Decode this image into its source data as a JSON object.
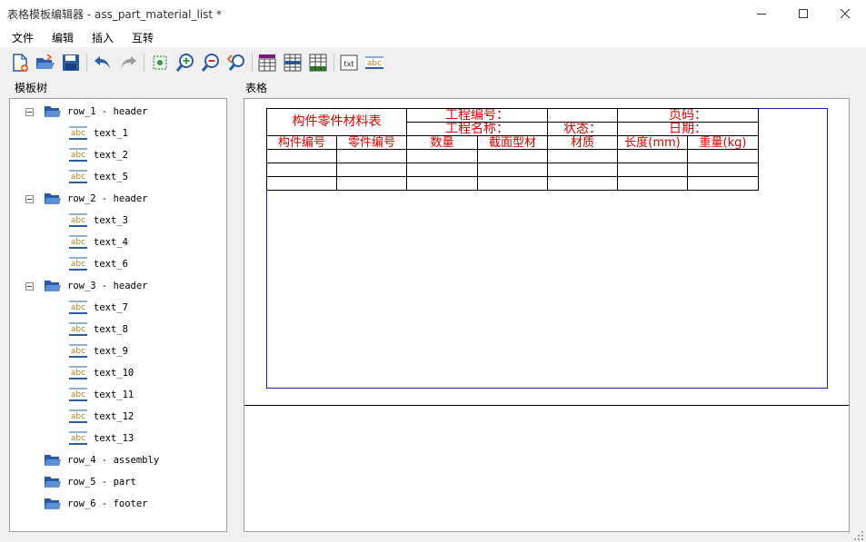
{
  "window": {
    "title": "表格模板编辑器 - ass_part_material_list *"
  },
  "menu": {
    "items": [
      "文件",
      "编辑",
      "插入",
      "互转"
    ]
  },
  "panels": {
    "tree_label": "模板树",
    "canvas_label": "表格"
  },
  "toolbar": {
    "icons": [
      "new-file-icon",
      "open-folder-icon",
      "save-icon",
      "undo-icon",
      "redo-icon",
      "fit-view-icon",
      "zoom-in-icon",
      "zoom-out-icon",
      "zoom-reset-icon",
      "table-style-1-icon",
      "table-style-2-icon",
      "table-style-3-icon",
      "text-txt-icon",
      "text-abc-icon"
    ],
    "txt_label": "txt",
    "abc_label": "abc"
  },
  "tree": {
    "abc_glyph": "abc",
    "nodes": [
      {
        "label": "row_1 - header",
        "type": "folder",
        "expanded": true
      },
      {
        "label": "text_1",
        "type": "text"
      },
      {
        "label": "text_2",
        "type": "text"
      },
      {
        "label": "text_5",
        "type": "text"
      },
      {
        "label": "row_2 - header",
        "type": "folder",
        "expanded": true
      },
      {
        "label": "text_3",
        "type": "text"
      },
      {
        "label": "text_4",
        "type": "text"
      },
      {
        "label": "text_6",
        "type": "text"
      },
      {
        "label": "row_3 - header",
        "type": "folder",
        "expanded": true
      },
      {
        "label": "text_7",
        "type": "text"
      },
      {
        "label": "text_8",
        "type": "text"
      },
      {
        "label": "text_9",
        "type": "text"
      },
      {
        "label": "text_10",
        "type": "text"
      },
      {
        "label": "text_11",
        "type": "text"
      },
      {
        "label": "text_12",
        "type": "text"
      },
      {
        "label": "text_13",
        "type": "text"
      },
      {
        "label": "row_4 - assembly",
        "type": "folder",
        "expanded": false
      },
      {
        "label": "row_5 - part",
        "type": "folder",
        "expanded": false
      },
      {
        "label": "row_6 - footer",
        "type": "folder",
        "expanded": false
      }
    ]
  },
  "table": {
    "title": "构件零件材料表",
    "project_no": "工程编号：",
    "project_name": "工程名称：",
    "status": "状态：",
    "page_no": "页码：",
    "date": "日期：",
    "columns": [
      "构件编号",
      "零件编号",
      "数量",
      "截面型材",
      "材质",
      "长度(mm)",
      "重量(kg)"
    ]
  },
  "colors": {
    "accent_text": "#e00000",
    "frame": "#1a1ac8",
    "icon_blue": "#2a5caa"
  }
}
